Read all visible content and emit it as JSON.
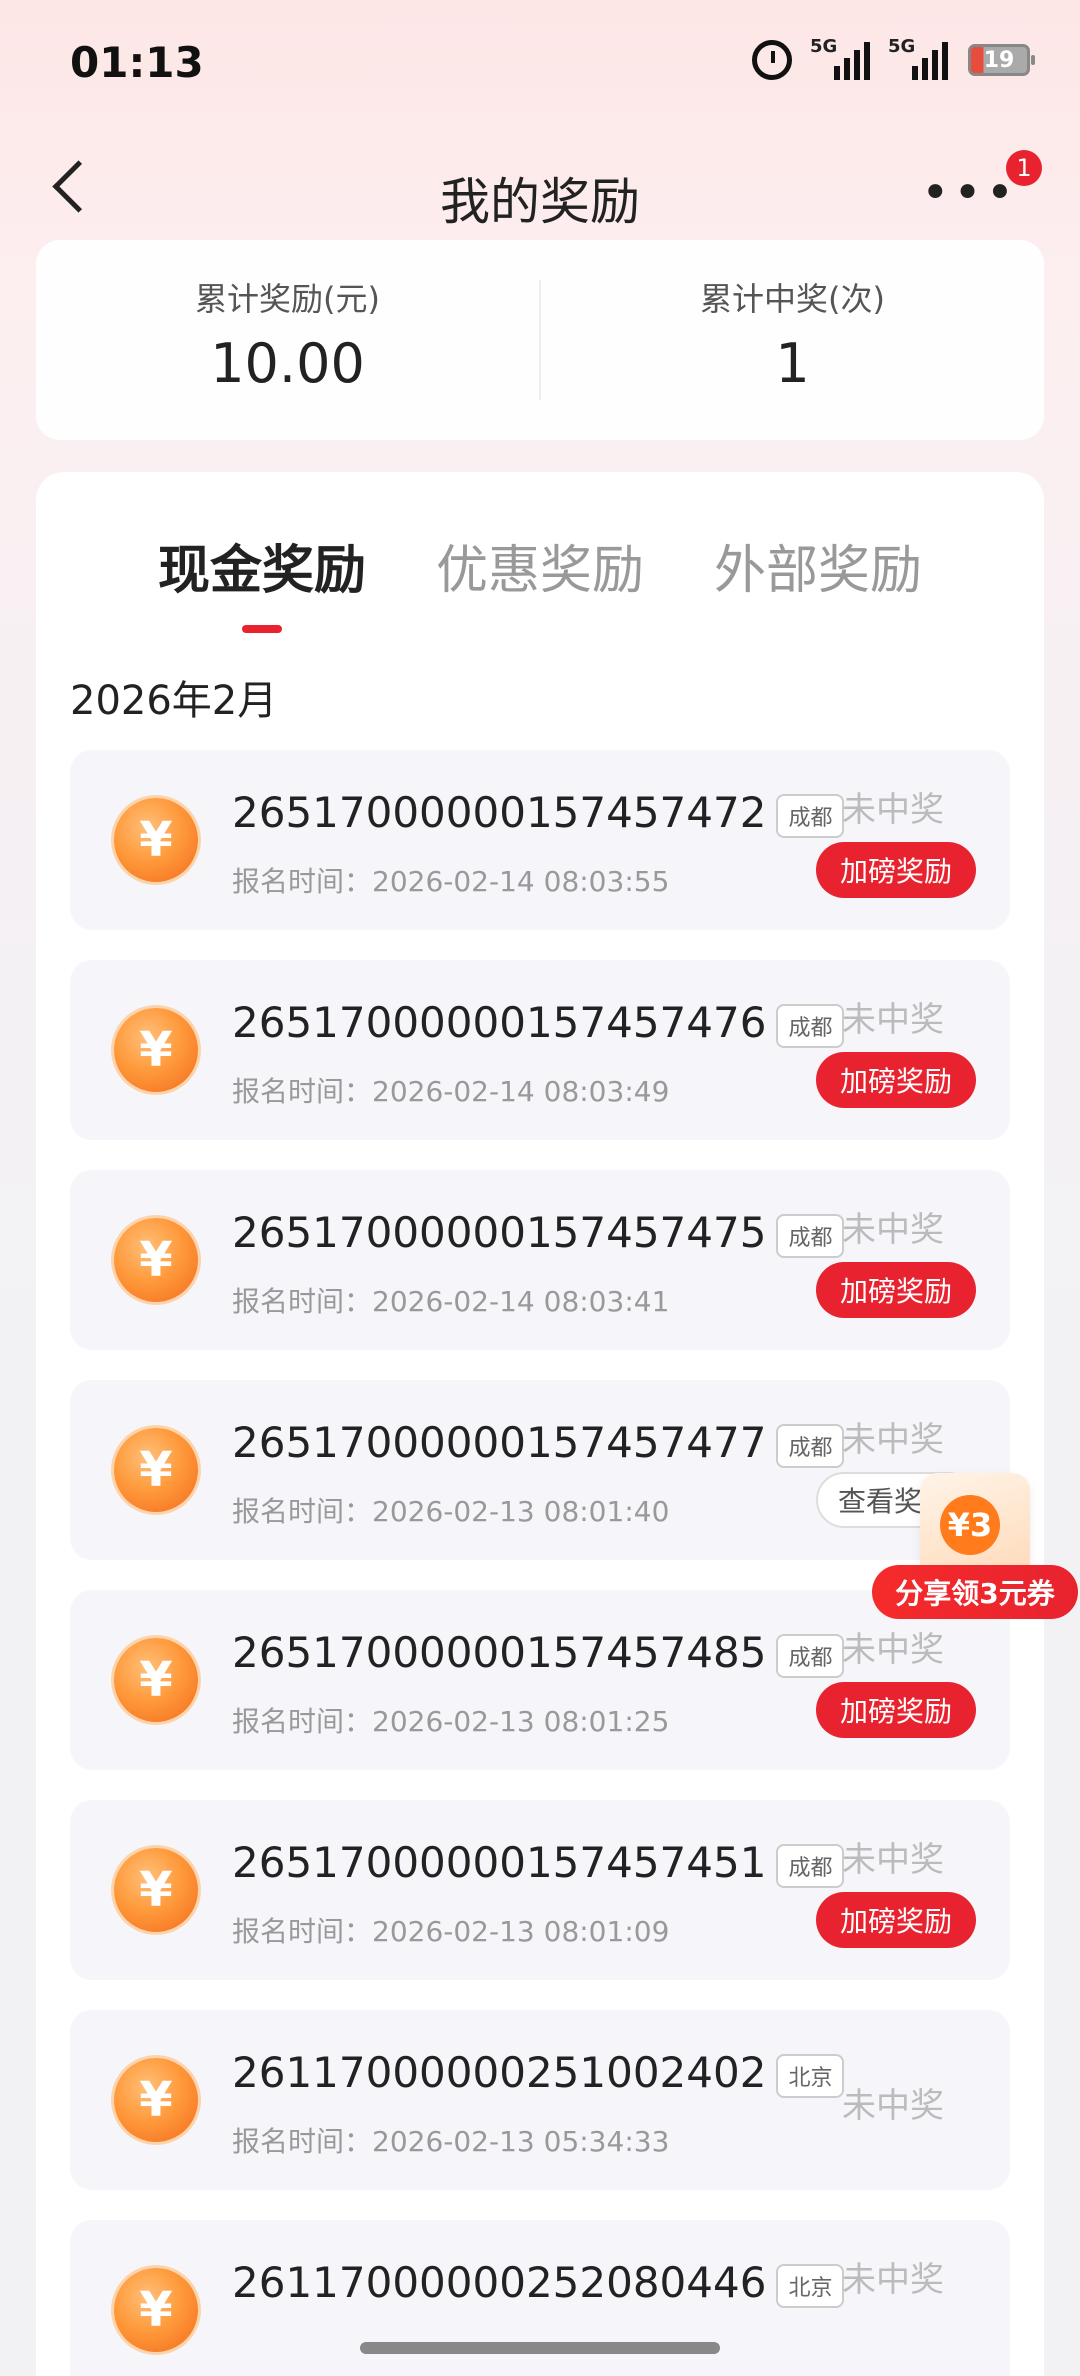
{
  "status_bar": {
    "time": "01:13",
    "signal1": "5G",
    "signal2": "5G",
    "battery": "19"
  },
  "header": {
    "title": "我的奖励",
    "badge": "1"
  },
  "summary": {
    "left_label": "累计奖励(元)",
    "left_value": "10.00",
    "right_label": "累计中奖(次)",
    "right_value": "1"
  },
  "tabs": [
    "现金奖励",
    "优惠奖励",
    "外部奖励"
  ],
  "month": "2026年2月",
  "coin_symbol": "¥",
  "items": [
    {
      "id": "26517000000157457472",
      "city": "成都",
      "time": "报名时间：2026-02-14 08:03:55",
      "status": "未中奖",
      "button": "加磅奖励"
    },
    {
      "id": "26517000000157457476",
      "city": "成都",
      "time": "报名时间：2026-02-14 08:03:49",
      "status": "未中奖",
      "button": "加磅奖励"
    },
    {
      "id": "26517000000157457475",
      "city": "成都",
      "time": "报名时间：2026-02-14 08:03:41",
      "status": "未中奖",
      "button": "加磅奖励"
    },
    {
      "id": "26517000000157457477",
      "city": "成都",
      "time": "报名时间：2026-02-13 08:01:40",
      "status": "未中奖",
      "button": "查看奖励"
    },
    {
      "id": "26517000000157457485",
      "city": "成都",
      "time": "报名时间：2026-02-13 08:01:25",
      "status": "未中奖",
      "button": "加磅奖励"
    },
    {
      "id": "26517000000157457451",
      "city": "成都",
      "time": "报名时间：2026-02-13 08:01:09",
      "status": "未中奖",
      "button": "加磅奖励"
    },
    {
      "id": "26117000000251002402",
      "city": "北京",
      "time": "报名时间：2026-02-13 05:34:33",
      "status": "未中奖",
      "button": ""
    },
    {
      "id": "26117000000252080446",
      "city": "北京",
      "time": "",
      "status": "未中奖",
      "button": ""
    }
  ],
  "float_ad": {
    "coin": "¥3",
    "label": "分享领3元券"
  },
  "colors": {
    "accent": "#e8232f",
    "coin": "#ff9a3c"
  }
}
